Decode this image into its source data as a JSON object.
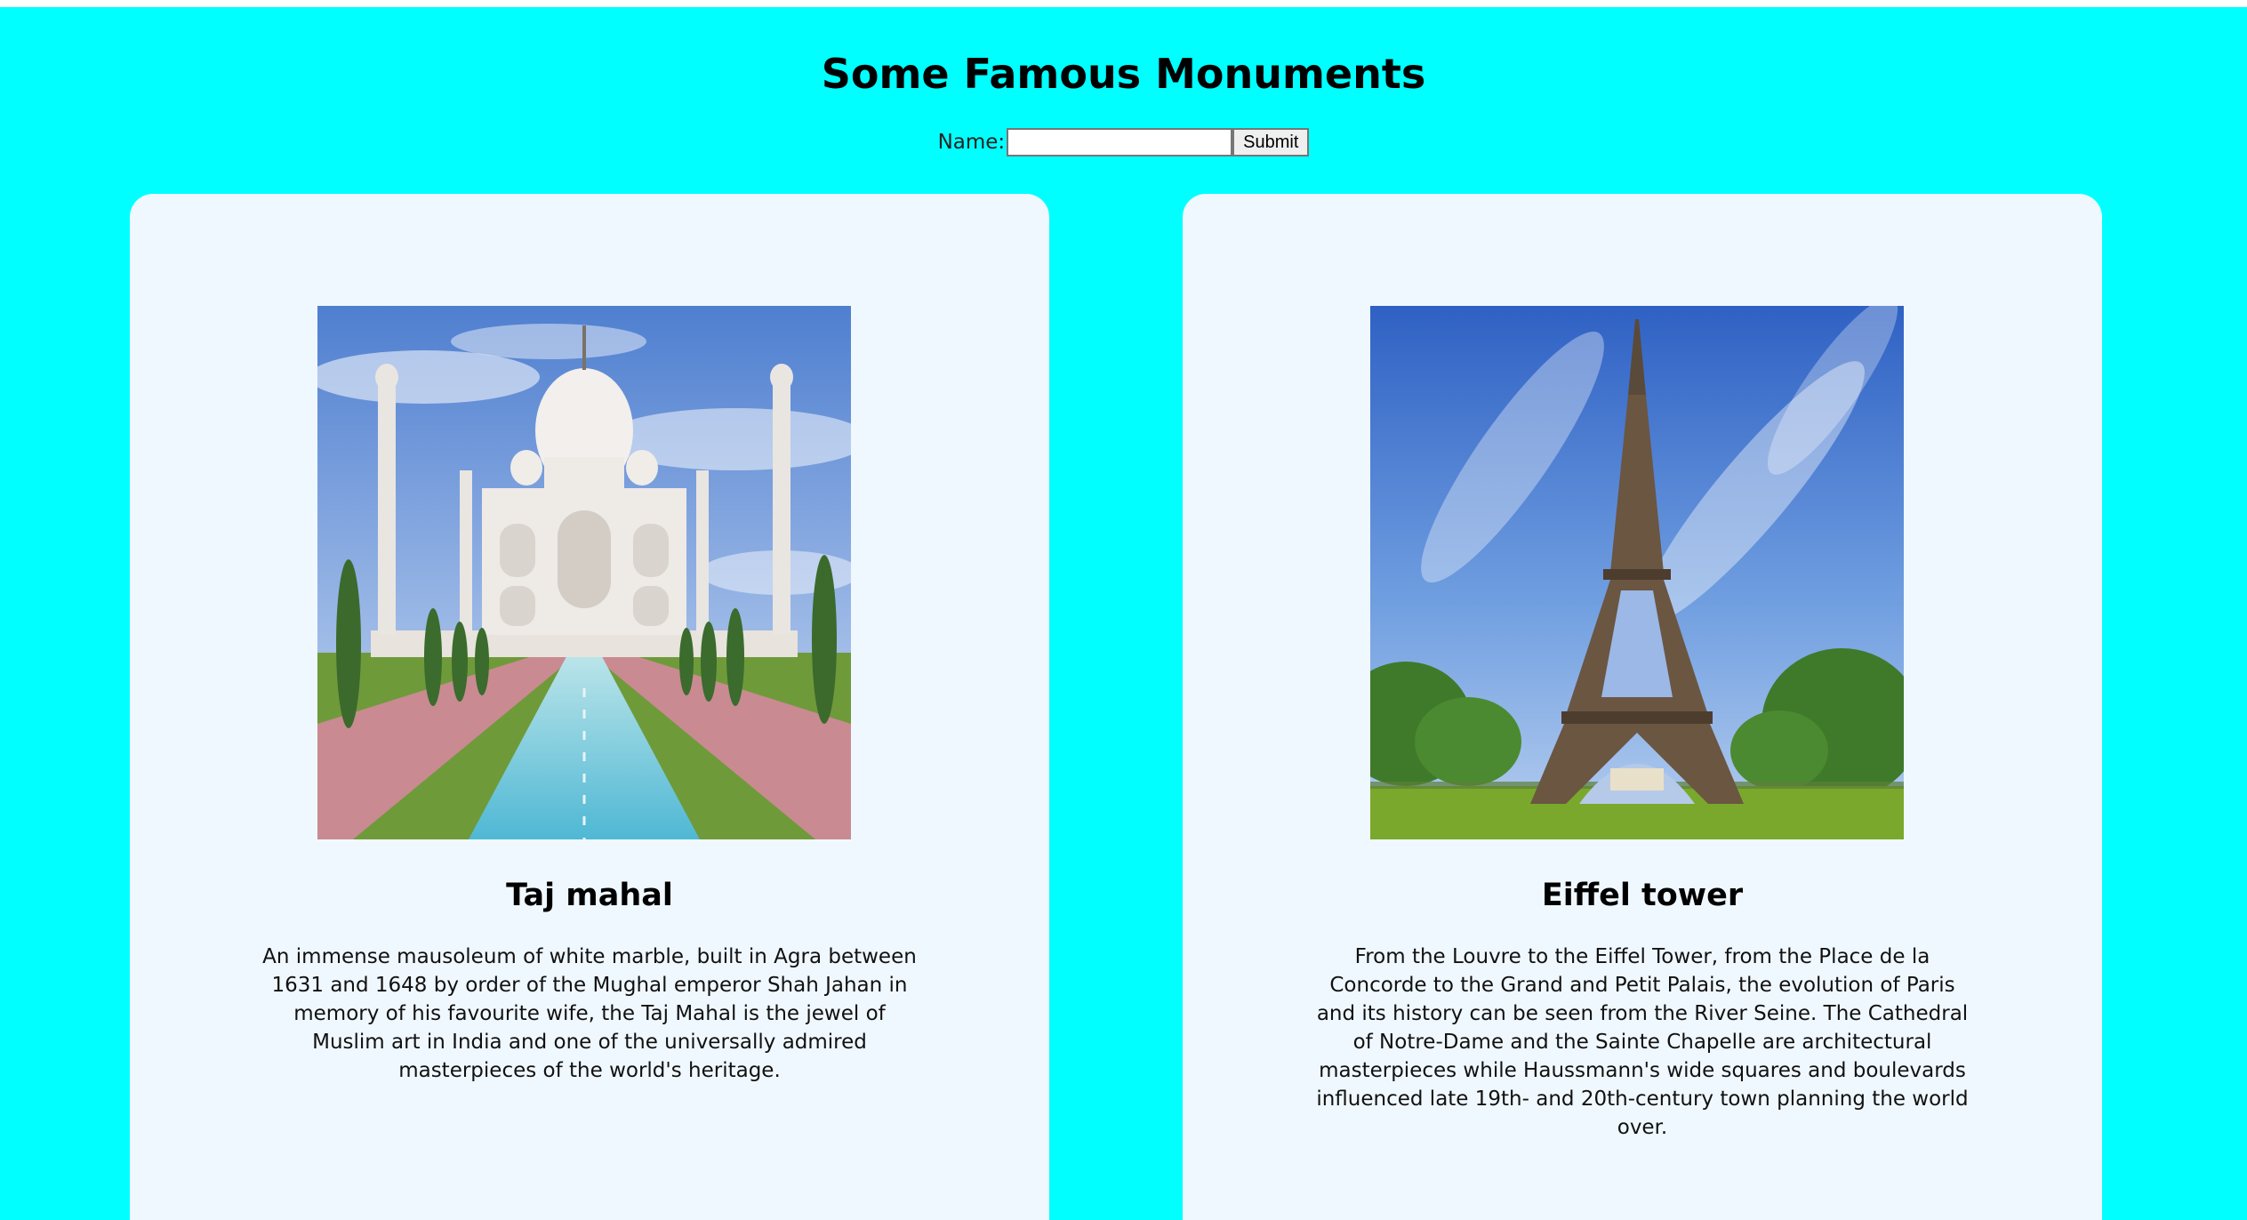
{
  "page": {
    "title": "Some Famous Monuments",
    "background_color": "#00ffff",
    "card_color": "#f0f8ff"
  },
  "form": {
    "name_label": "Name:",
    "name_value": "",
    "name_placeholder": "",
    "submit_label": "Submit"
  },
  "monuments": [
    {
      "image_icon": "taj-mahal-photo",
      "title": "Taj mahal",
      "description": "An immense mausoleum of white marble, built in Agra between 1631 and 1648 by order of the Mughal emperor Shah Jahan in memory of his favourite wife, the Taj Mahal is the jewel of Muslim art in India and one of the universally admired masterpieces of the world's heritage."
    },
    {
      "image_icon": "eiffel-tower-photo",
      "title": "Eiffel tower",
      "description": "From the Louvre to the Eiffel Tower, from the Place de la Concorde to the Grand and Petit Palais, the evolution of Paris and its history can be seen from the River Seine. The Cathedral of Notre-Dame and the Sainte Chapelle are architectural masterpieces while Haussmann's wide squares and boulevards influenced late 19th- and 20th-century town planning the world over."
    }
  ]
}
